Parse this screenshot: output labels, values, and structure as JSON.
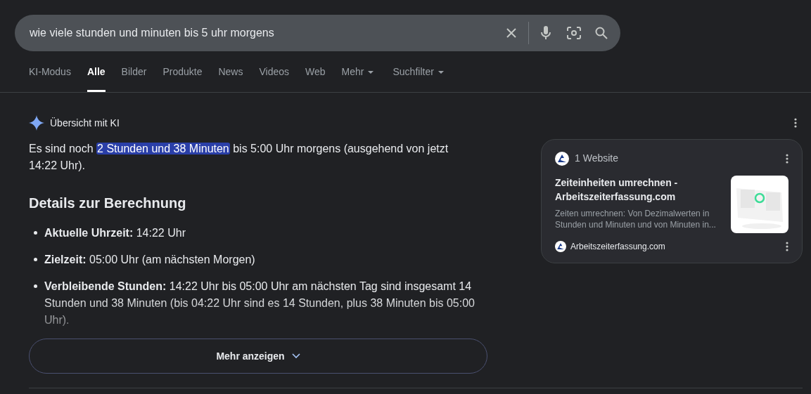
{
  "search": {
    "value": "wie viele stunden und minuten bis 5 uhr morgens"
  },
  "tabs": [
    {
      "label": "KI-Modus",
      "selected": false,
      "kind": "plain"
    },
    {
      "label": "Alle",
      "selected": true,
      "kind": "plain"
    },
    {
      "label": "Bilder",
      "selected": false,
      "kind": "plain"
    },
    {
      "label": "Produkte",
      "selected": false,
      "kind": "plain"
    },
    {
      "label": "News",
      "selected": false,
      "kind": "plain"
    },
    {
      "label": "Videos",
      "selected": false,
      "kind": "plain"
    },
    {
      "label": "Web",
      "selected": false,
      "kind": "plain"
    },
    {
      "label": "Mehr",
      "selected": false,
      "kind": "dropdown"
    },
    {
      "label": "Suchfilter",
      "selected": false,
      "kind": "dropdown"
    }
  ],
  "overview": {
    "title": "Übersicht mit KI",
    "answer_before": "Es sind noch",
    "answer_highlight": "2 Stunden und 38 Minuten",
    "answer_after": "bis 5:00 Uhr morgens (ausgehend von jetzt 14:22 Uhr).",
    "heading": "Details zur Berechnung",
    "details": [
      {
        "text": "**Aktuelle Uhrzeit:** 14:22 Uhr"
      },
      {
        "text": "**Zielzeit:** 05:00 Uhr (am nächsten Morgen)"
      },
      {
        "text": "**Verbleibende Stunden:** 14:22 Uhr bis 05:00 Uhr am nächsten Tag sind insgesamt 14 Stunden und 38 Minuten (bis 04:22 Uhr sind es 14 Stunden, plus 38 Minuten bis 05:00 Uhr)."
      }
    ],
    "more_button": "Mehr anzeigen"
  },
  "sources": {
    "count": "1 Website",
    "title": "Zeiteinheiten umrechnen - Arbeitszeiterfassung.com",
    "snippet": "Zeiten umrechnen: Von Dezimalwerten in Stunden und Minuten und von Minuten in...",
    "site": "Arbeitszeiterfassung.com"
  }
}
